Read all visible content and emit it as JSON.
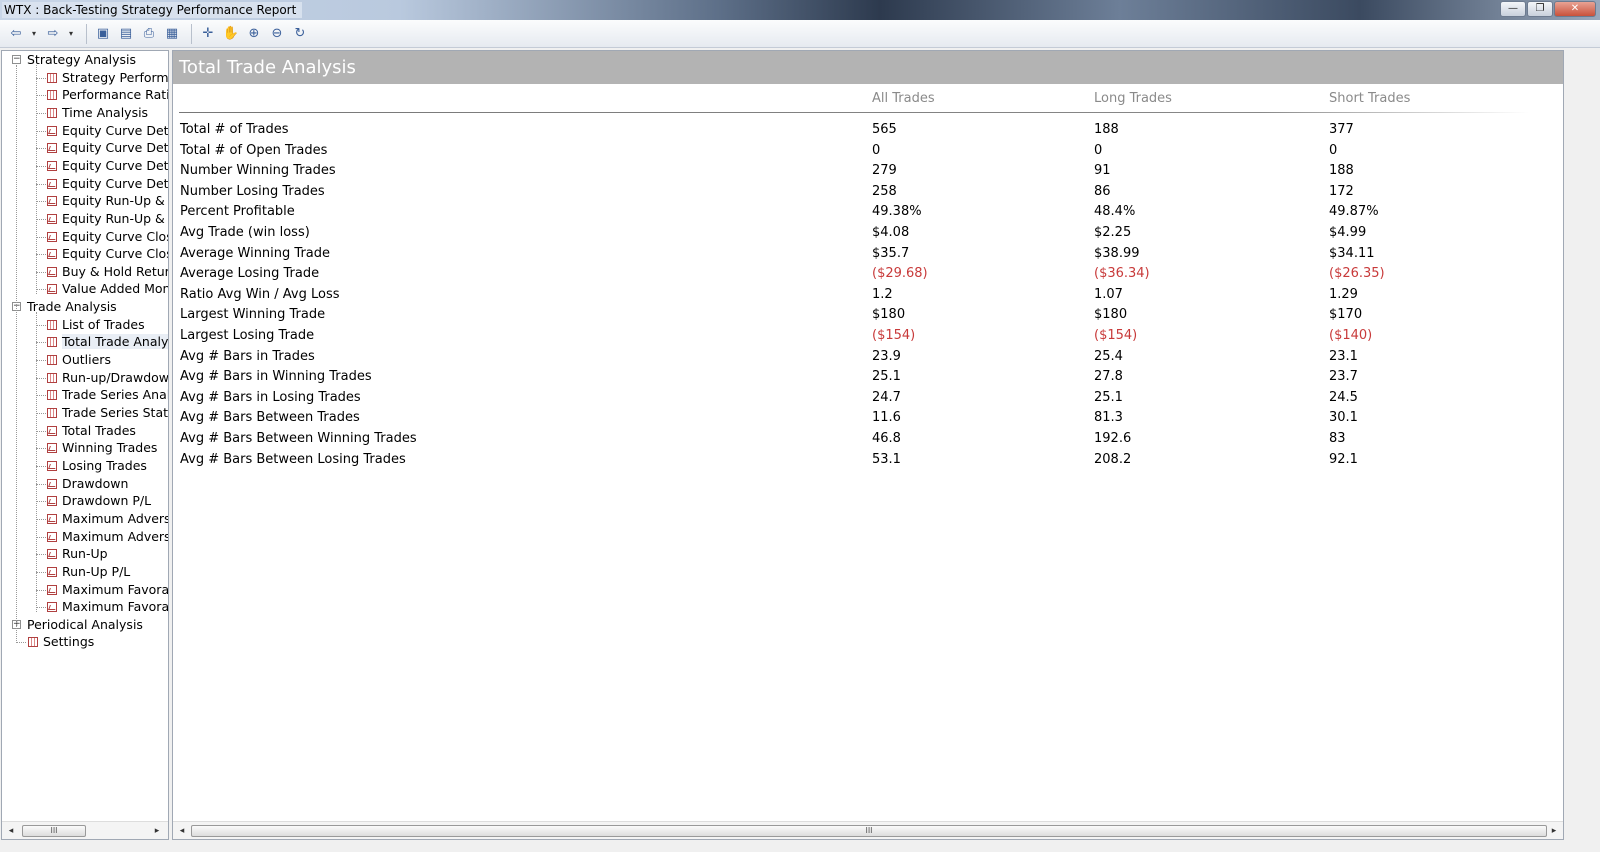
{
  "window": {
    "title": "WTX :  Back-Testing Strategy Performance Report",
    "min_symbol": "—",
    "max_symbol": "❐",
    "close_symbol": "✕"
  },
  "tree": {
    "groups": [
      {
        "label": "Strategy Analysis",
        "expander": "−",
        "items": [
          {
            "label": "Strategy Performar",
            "icon": "table"
          },
          {
            "label": "Performance Ratios",
            "icon": "table"
          },
          {
            "label": "Time Analysis",
            "icon": "table"
          },
          {
            "label": "Equity Curve Detail",
            "icon": "chart"
          },
          {
            "label": "Equity Curve Detail",
            "icon": "chart"
          },
          {
            "label": "Equity Curve Detail",
            "icon": "chart"
          },
          {
            "label": "Equity Curve Detail",
            "icon": "chart"
          },
          {
            "label": "Equity Run-Up & D",
            "icon": "chart"
          },
          {
            "label": "Equity Run-Up & D",
            "icon": "chart"
          },
          {
            "label": "Equity Curve Close",
            "icon": "chart"
          },
          {
            "label": "Equity Curve Close",
            "icon": "chart"
          },
          {
            "label": "Buy & Hold Return",
            "icon": "chart"
          },
          {
            "label": "Value Added Mont",
            "icon": "chart"
          }
        ]
      },
      {
        "label": "Trade Analysis",
        "expander": "−",
        "items": [
          {
            "label": "List of Trades",
            "icon": "table"
          },
          {
            "label": "Total Trade Analysi",
            "icon": "table"
          },
          {
            "label": "Outliers",
            "icon": "table"
          },
          {
            "label": "Run-up/Drawdown",
            "icon": "table"
          },
          {
            "label": "Trade Series Analys",
            "icon": "table"
          },
          {
            "label": "Trade Series Statist",
            "icon": "table"
          },
          {
            "label": "Total Trades",
            "icon": "chart"
          },
          {
            "label": "Winning Trades",
            "icon": "chart"
          },
          {
            "label": "Losing Trades",
            "icon": "chart"
          },
          {
            "label": "Drawdown",
            "icon": "chart"
          },
          {
            "label": "Drawdown P/L",
            "icon": "chart"
          },
          {
            "label": "Maximum Adverse",
            "icon": "chart"
          },
          {
            "label": "Maximum Adverse",
            "icon": "chart"
          },
          {
            "label": "Run-Up",
            "icon": "chart"
          },
          {
            "label": "Run-Up P/L",
            "icon": "chart"
          },
          {
            "label": "Maximum Favorab",
            "icon": "chart"
          },
          {
            "label": "Maximum Favorab",
            "icon": "chart"
          }
        ]
      },
      {
        "label": "Periodical Analysis",
        "expander": "+",
        "items": []
      }
    ],
    "settings_label": "Settings",
    "selected": "Total Trade Analysi"
  },
  "report": {
    "title": "Total Trade Analysis",
    "columns": [
      "All Trades",
      "Long Trades",
      "Short Trades"
    ],
    "rows": [
      {
        "label": "Total # of Trades",
        "all": "565",
        "long": "188",
        "short": "377",
        "negative": false
      },
      {
        "label": "Total # of Open Trades",
        "all": "0",
        "long": "0",
        "short": "0",
        "negative": false
      },
      {
        "label": "Number Winning Trades",
        "all": "279",
        "long": "91",
        "short": "188",
        "negative": false
      },
      {
        "label": "Number Losing Trades",
        "all": "258",
        "long": "86",
        "short": "172",
        "negative": false
      },
      {
        "label": "Percent Profitable",
        "all": "49.38%",
        "long": "48.4%",
        "short": "49.87%",
        "negative": false
      },
      {
        "label": "Avg Trade (win  loss)",
        "all": "$4.08",
        "long": "$2.25",
        "short": "$4.99",
        "negative": false
      },
      {
        "label": "Average Winning Trade",
        "all": "$35.7",
        "long": "$38.99",
        "short": "$34.11",
        "negative": false
      },
      {
        "label": "Average Losing Trade",
        "all": "($29.68)",
        "long": "($36.34)",
        "short": "($26.35)",
        "negative": true
      },
      {
        "label": "Ratio Avg Win / Avg Loss",
        "all": "1.2",
        "long": "1.07",
        "short": "1.29",
        "negative": false
      },
      {
        "label": "Largest Winning Trade",
        "all": "$180",
        "long": "$180",
        "short": "$170",
        "negative": false
      },
      {
        "label": "Largest Losing Trade",
        "all": "($154)",
        "long": "($154)",
        "short": "($140)",
        "negative": true
      },
      {
        "label": "Avg # Bars in Trades",
        "all": "23.9",
        "long": "25.4",
        "short": "23.1",
        "negative": false
      },
      {
        "label": "Avg # Bars in Winning Trades",
        "all": "25.1",
        "long": "27.8",
        "short": "23.7",
        "negative": false
      },
      {
        "label": "Avg # Bars in Losing Trades",
        "all": "24.7",
        "long": "25.1",
        "short": "24.5",
        "negative": false
      },
      {
        "label": "Avg # Bars Between Trades",
        "all": "11.6",
        "long": "81.3",
        "short": "30.1",
        "negative": false
      },
      {
        "label": "Avg # Bars Between Winning Trades",
        "all": "46.8",
        "long": "192.6",
        "short": "83",
        "negative": false
      },
      {
        "label": "Avg # Bars Between Losing Trades",
        "all": "53.1",
        "long": "208.2",
        "short": "92.1",
        "negative": false
      }
    ]
  },
  "toolbar": {
    "buttons": [
      {
        "name": "back-icon",
        "glyph": "⇦"
      },
      {
        "name": "forward-icon",
        "glyph": "⇨"
      },
      {
        "name": "save-icon",
        "glyph": "▣"
      },
      {
        "name": "print-preview-icon",
        "glyph": "▤"
      },
      {
        "name": "print-icon",
        "glyph": "⎙"
      },
      {
        "name": "page-setup-icon",
        "glyph": "▦"
      },
      {
        "name": "crosshair-icon",
        "glyph": "✛"
      },
      {
        "name": "pan-hand-icon",
        "glyph": "✋"
      },
      {
        "name": "zoom-in-icon",
        "glyph": "⊕"
      },
      {
        "name": "zoom-out-icon",
        "glyph": "⊖"
      },
      {
        "name": "refresh-icon",
        "glyph": "↻"
      }
    ],
    "dropdown_glyph": "▾"
  },
  "scroll": {
    "left_arrow": "◂",
    "right_arrow": "▸",
    "thumb_grip": "III"
  },
  "colors": {
    "negative": "#c83a3a",
    "header_bg": "#b3b3b3",
    "column_head": "#8a8a8a"
  }
}
